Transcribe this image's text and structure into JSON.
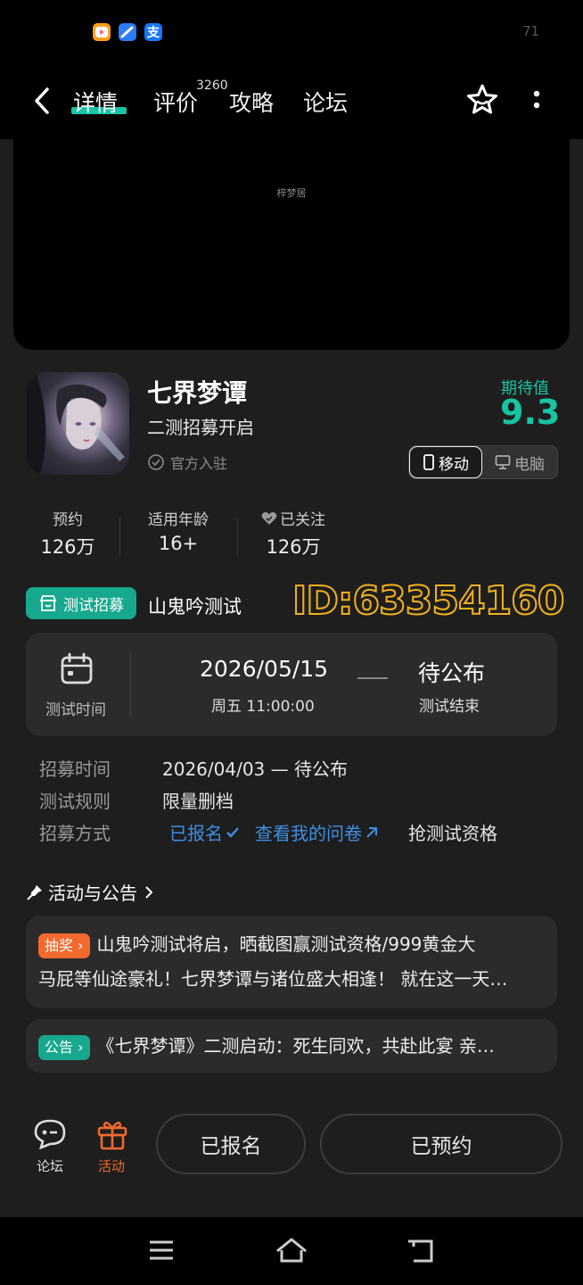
{
  "status_bar": {
    "apps": [
      "video-app-icon",
      "feather-app-icon",
      "alipay-icon"
    ],
    "alipay_glyph": "支",
    "number": "71"
  },
  "top_nav": {
    "tabs": [
      {
        "label": "详情"
      },
      {
        "label": "评价"
      },
      {
        "label": "攻略"
      },
      {
        "label": "论坛"
      }
    ],
    "review_count": "3260"
  },
  "video": {
    "watermark": "梓梦居"
  },
  "game": {
    "title": "七界梦谭",
    "subtitle": "二测招募开启",
    "official": "官方入驻",
    "expectation_label": "期待值",
    "expectation_value": "9.3"
  },
  "platform": {
    "mobile": "移动",
    "pc": "电脑"
  },
  "stats": [
    {
      "label": "预约",
      "value": "126万"
    },
    {
      "label": "适用年龄",
      "value": "16+"
    },
    {
      "label": "已关注",
      "value": "126万"
    }
  ],
  "recruit": {
    "tag": "测试招募",
    "name": "山鬼吟测试"
  },
  "overlay_id": "ID:63354160",
  "test_time": {
    "label": "测试时间",
    "date": "2026/05/15",
    "day_time": "周五  11:00:00",
    "pending": "待公布",
    "end_label": "测试结束"
  },
  "info": [
    {
      "key": "招募时间",
      "value": "2026/04/03 — 待公布"
    },
    {
      "key": "测试规则",
      "value": "限量删档"
    },
    {
      "key": "招募方式",
      "signed": "已报名",
      "questionnaire": "查看我的问卷",
      "qualify": "抢测试资格"
    }
  ],
  "activities": {
    "title": "活动与公告",
    "items": [
      {
        "tag": "抽奖",
        "text_line1": "山鬼吟测试将启，晒截图赢测试资格/999黄金大",
        "text_line2": "马屁等仙途豪礼！七界梦谭与诸位盛大相逢！ 就在这一天…"
      },
      {
        "tag": "公告",
        "text": "《七界梦谭》二测启动：死生同欢，共赴此宴 亲…"
      }
    ]
  },
  "bottom": {
    "forum": "论坛",
    "activity": "活动",
    "signed": "已报名",
    "reserved": "已预约"
  },
  "colors": {
    "accent": "#17c4a4",
    "orange": "#f26a2e",
    "link": "#3d8fe6",
    "id_overlay": "#f3b21a"
  }
}
